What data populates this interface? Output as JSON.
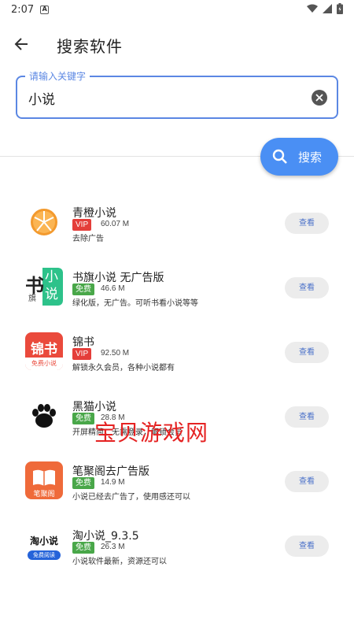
{
  "status_bar": {
    "time": "2:07",
    "notification_letter": "A"
  },
  "header": {
    "title": "搜索软件"
  },
  "search": {
    "legend": "请输入关键字",
    "value": "小说",
    "button_label": "搜索"
  },
  "watermark": "宝贝游戏网",
  "apps": [
    {
      "name": "青橙小说",
      "badge": "VIP",
      "badge_type": "vip",
      "size": "60.07 M",
      "description": "去除广告",
      "action": "查看"
    },
    {
      "name": "书旗小说 无广告版",
      "badge": "免费",
      "badge_type": "free",
      "size": "46.6 M",
      "description": "绿化版，无广告。可听书看小说等等",
      "action": "查看",
      "icon_text": [
        "书",
        "小",
        "说",
        "旗"
      ]
    },
    {
      "name": "锦书",
      "badge": "VIP",
      "badge_type": "vip",
      "size": "92.50 M",
      "description": "解锁永久会员，各种小说都有",
      "action": "查看",
      "icon_text": [
        "锦书",
        "免费小说"
      ]
    },
    {
      "name": "黑猫小说",
      "badge": "免费",
      "badge_type": "free",
      "size": "28.8 M",
      "description": "开屏精简，无需登录，解锁会员",
      "action": "查看"
    },
    {
      "name": "笔聚阁去广告版",
      "badge": "免费",
      "badge_type": "free",
      "size": "14.9 M",
      "description": "小说已经去广告了，使用感还可以",
      "action": "查看",
      "icon_text": [
        "笔聚阁"
      ]
    },
    {
      "name": "淘小说_9.3.5",
      "badge": "免费",
      "badge_type": "free",
      "size": "26.3 M",
      "description": "小说软件最新，资源还可以",
      "action": "查看",
      "icon_text": [
        "淘小说",
        "免费阅读"
      ]
    }
  ],
  "colors": {
    "accent": "#4a8ff4",
    "field_border": "#5b87e3",
    "vip": "#e43e3a",
    "free": "#49a749",
    "watermark": "#e52222"
  }
}
